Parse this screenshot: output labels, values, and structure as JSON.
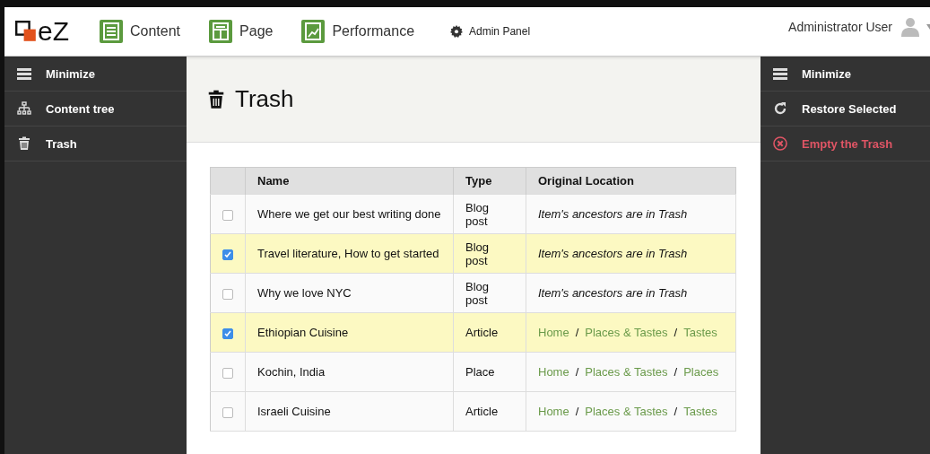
{
  "header": {
    "logo": "eZ",
    "nav": [
      {
        "label": "Content"
      },
      {
        "label": "Page"
      },
      {
        "label": "Performance"
      }
    ],
    "admin": "Admin Panel",
    "user": "Administrator User"
  },
  "left_sidebar": [
    {
      "label": "Minimize"
    },
    {
      "label": "Content tree"
    },
    {
      "label": "Trash"
    }
  ],
  "title": "Trash",
  "table": {
    "columns": [
      "Name",
      "Type",
      "Original Location"
    ],
    "rows": [
      {
        "checked": false,
        "name": "Where we get our best writing done",
        "type": "Blog post",
        "location": {
          "kind": "note",
          "text": "Item's ancestors are in Trash"
        }
      },
      {
        "checked": true,
        "name": "Travel literature, How to get started",
        "type": "Blog post",
        "location": {
          "kind": "note",
          "text": "Item's ancestors are in Trash"
        }
      },
      {
        "checked": false,
        "name": "Why we love NYC",
        "type": "Blog post",
        "location": {
          "kind": "note",
          "text": "Item's ancestors are in Trash"
        }
      },
      {
        "checked": true,
        "name": "Ethiopian Cuisine",
        "type": "Article",
        "location": {
          "kind": "path",
          "separator": "/",
          "links": [
            "Home",
            "Places & Tastes",
            "Tastes"
          ]
        }
      },
      {
        "checked": false,
        "name": "Kochin, India",
        "type": "Place",
        "location": {
          "kind": "path",
          "separator": "/",
          "links": [
            "Home",
            "Places & Tastes",
            "Places"
          ]
        }
      },
      {
        "checked": false,
        "name": "Israeli Cuisine",
        "type": "Article",
        "location": {
          "kind": "path",
          "separator": "/",
          "links": [
            "Home",
            "Places & Tastes",
            "Tastes"
          ]
        }
      }
    ]
  },
  "right_sidebar": [
    {
      "label": "Minimize",
      "kind": "normal"
    },
    {
      "label": "Restore Selected",
      "kind": "normal"
    },
    {
      "label": "Empty the Trash",
      "kind": "danger"
    }
  ]
}
